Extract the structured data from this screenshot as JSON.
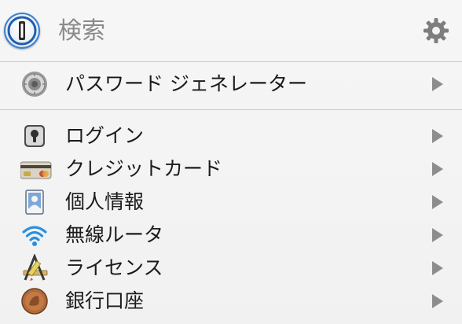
{
  "search": {
    "placeholder": "検索"
  },
  "generator": {
    "label": "パスワード ジェネレーター"
  },
  "categories": [
    {
      "label": "ログイン",
      "icon": "login-keyhole-icon"
    },
    {
      "label": "クレジットカード",
      "icon": "credit-card-icon"
    },
    {
      "label": "個人情報",
      "icon": "identity-icon"
    },
    {
      "label": "無線ルータ",
      "icon": "wifi-icon"
    },
    {
      "label": "ライセンス",
      "icon": "license-icon"
    },
    {
      "label": "銀行口座",
      "icon": "bank-account-coin-icon"
    }
  ],
  "colors": {
    "accent": "#3b7fd0",
    "chevron": "#8d8d8d",
    "divider": "#c9c9c9"
  }
}
